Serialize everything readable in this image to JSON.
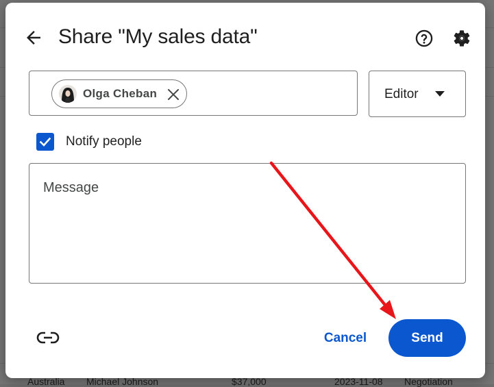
{
  "dialog": {
    "title": "Share \"My sales data\"",
    "back_icon": "arrow-left-icon",
    "help_icon": "help-circle-icon",
    "settings_icon": "gear-icon"
  },
  "people": {
    "chips": [
      {
        "name": "Olga Cheban",
        "remove_icon": "close-icon",
        "avatar": "avatar"
      }
    ]
  },
  "role": {
    "selected": "Editor",
    "caret_icon": "caret-down-icon"
  },
  "notify": {
    "label": "Notify people",
    "checked": true
  },
  "message": {
    "placeholder": "Message",
    "value": ""
  },
  "footer": {
    "link_icon": "link-icon",
    "cancel_label": "Cancel",
    "send_label": "Send"
  },
  "background": {
    "cells": [
      "Australia",
      "Michael Johnson",
      "$37,000",
      "2023-11-08",
      "Negotiation"
    ]
  },
  "colors": {
    "accent": "#0b57d0",
    "annotation": "#e8161a",
    "text": "#1f1f1f",
    "outline": "#747775"
  }
}
